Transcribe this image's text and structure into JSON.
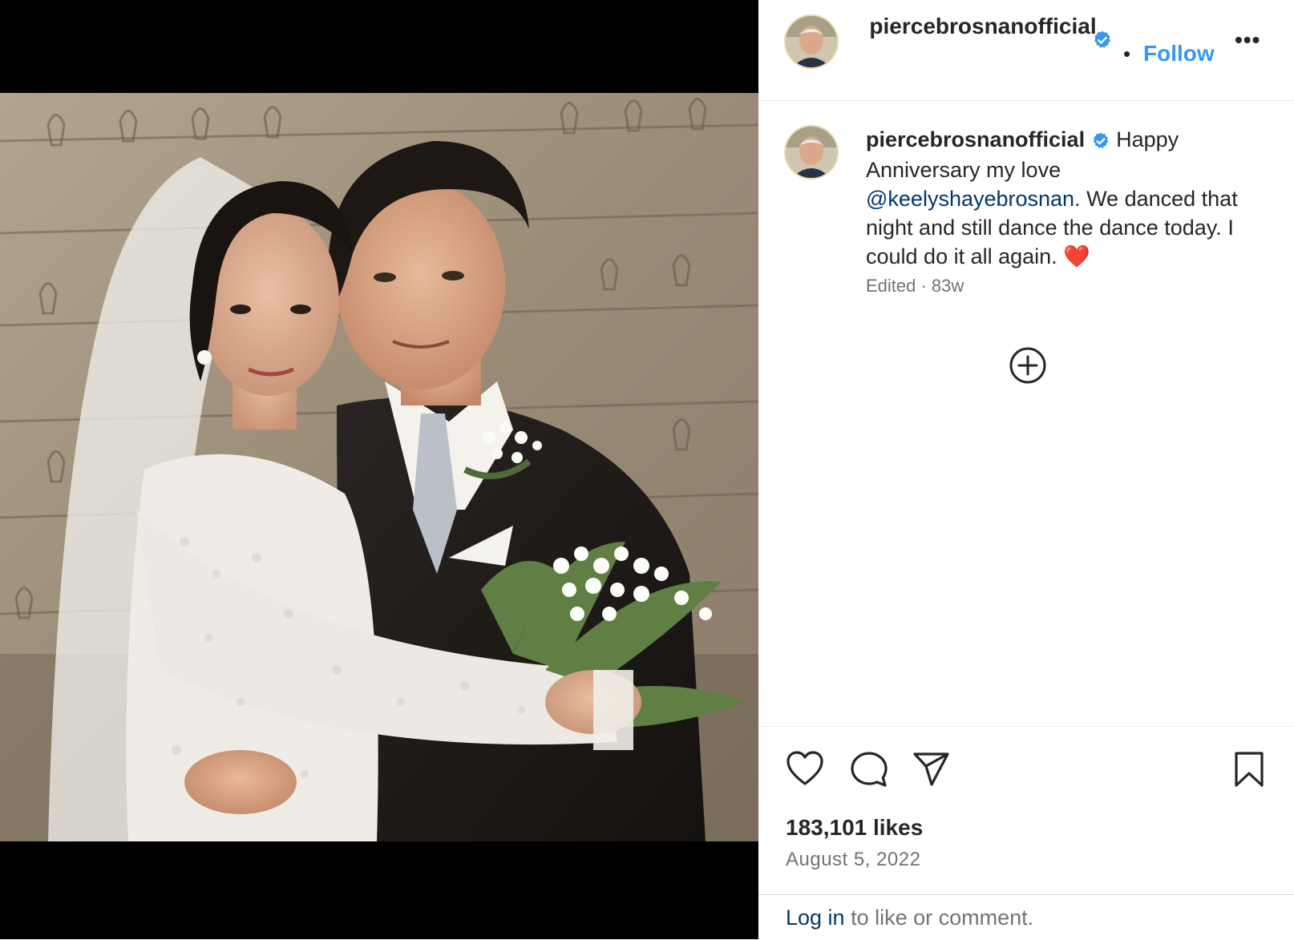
{
  "post": {
    "image_alt": "Wedding photo of a couple embracing in front of a carved stone wall; bride in lace gown and veil holding a bouquet of lily of the valley",
    "colors": {
      "follow": "#3897f0",
      "link": "#00376b",
      "muted": "#737373",
      "verified": "#3897f0",
      "heart_emoji": "#e0245e"
    }
  },
  "header": {
    "username": "piercebrosnanofficial",
    "follow_label": "Follow",
    "separator": "•",
    "more_label": "•••"
  },
  "caption": {
    "username": "piercebrosnanofficial",
    "text_before": "Happy Anniversary my love",
    "mention": "@keelyshayebrosnan",
    "text_after": ". We danced that night and still dance the dance today. I could do it all again. ❤️",
    "meta": "Edited · 83w"
  },
  "actions": {
    "icons": [
      "heart-icon",
      "comment-icon",
      "share-icon",
      "bookmark-icon",
      "add-circle-icon"
    ],
    "likes": "183,101 likes",
    "date": "August 5, 2022"
  },
  "login": {
    "link": "Log in",
    "rest": " to like or comment."
  }
}
